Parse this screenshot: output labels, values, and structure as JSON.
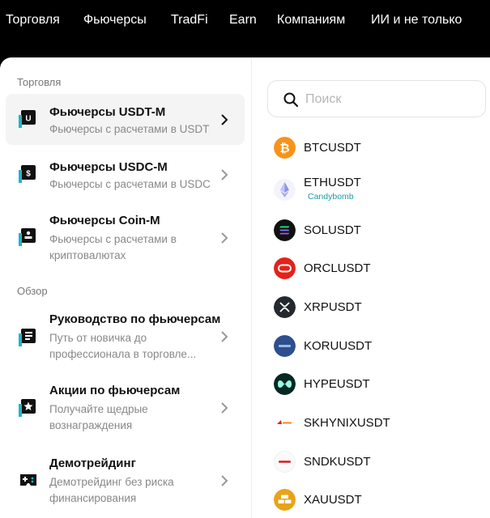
{
  "topnav": {
    "items": [
      "Торговля",
      "Фьючерсы",
      "TradFi",
      "Earn",
      "Компаниям",
      "ИИ и не только"
    ]
  },
  "left": {
    "sections": [
      {
        "title": "Торговля",
        "items": [
          {
            "title": "Фьючерсы USDT-M",
            "desc": "Фьючерсы с расчетами в USDT",
            "icon": "usdt-futures-icon",
            "active": true
          },
          {
            "title": "Фьючерсы USDC-M",
            "desc": "Фьючерсы с расчетами в USDC",
            "icon": "usdc-futures-icon"
          },
          {
            "title": "Фьючерсы Coin-M",
            "desc": "Фьючерсы с расчетами в криптовалютах",
            "icon": "coin-futures-icon"
          }
        ]
      },
      {
        "title": "Обзор",
        "items": [
          {
            "title": "Руководство по фьючерсам",
            "desc": "Путь от новичка до профессионала в торговле...",
            "icon": "guide-icon"
          },
          {
            "title": "Акции по фьючерсам",
            "desc": "Получайте щедрые вознаграждения",
            "icon": "promo-star-icon"
          },
          {
            "title": "Демотрейдинг",
            "desc": "Демотрейдинг без риска финансирования",
            "icon": "gamepad-icon"
          }
        ]
      }
    ]
  },
  "search": {
    "placeholder": "Поиск",
    "value": ""
  },
  "coins": [
    {
      "name": "BTCUSDT",
      "icon": "bitcoin-icon",
      "color": "#f7931a"
    },
    {
      "name": "ETHUSDT",
      "tag": "Candybomb",
      "icon": "ethereum-icon",
      "color": "#eef0fb"
    },
    {
      "name": "SOLUSDT",
      "icon": "solana-icon",
      "color": "#111111"
    },
    {
      "name": "ORCLUSDT",
      "icon": "oracle-icon",
      "color": "#e2231a"
    },
    {
      "name": "XRPUSDT",
      "icon": "xrp-icon",
      "color": "#23292f"
    },
    {
      "name": "KORUUSDT",
      "icon": "koru-icon",
      "color": "#2d4f8e"
    },
    {
      "name": "HYPEUSDT",
      "icon": "hyperliquid-icon",
      "color": "#072723"
    },
    {
      "name": "SKHYNIXUSDT",
      "icon": "skhynix-icon",
      "color": "#e2231a"
    },
    {
      "name": "SNDKUSDT",
      "icon": "sandisk-icon",
      "color": "#d71920"
    },
    {
      "name": "XAUUSDT",
      "icon": "gold-icon",
      "color": "#e8a317"
    }
  ]
}
